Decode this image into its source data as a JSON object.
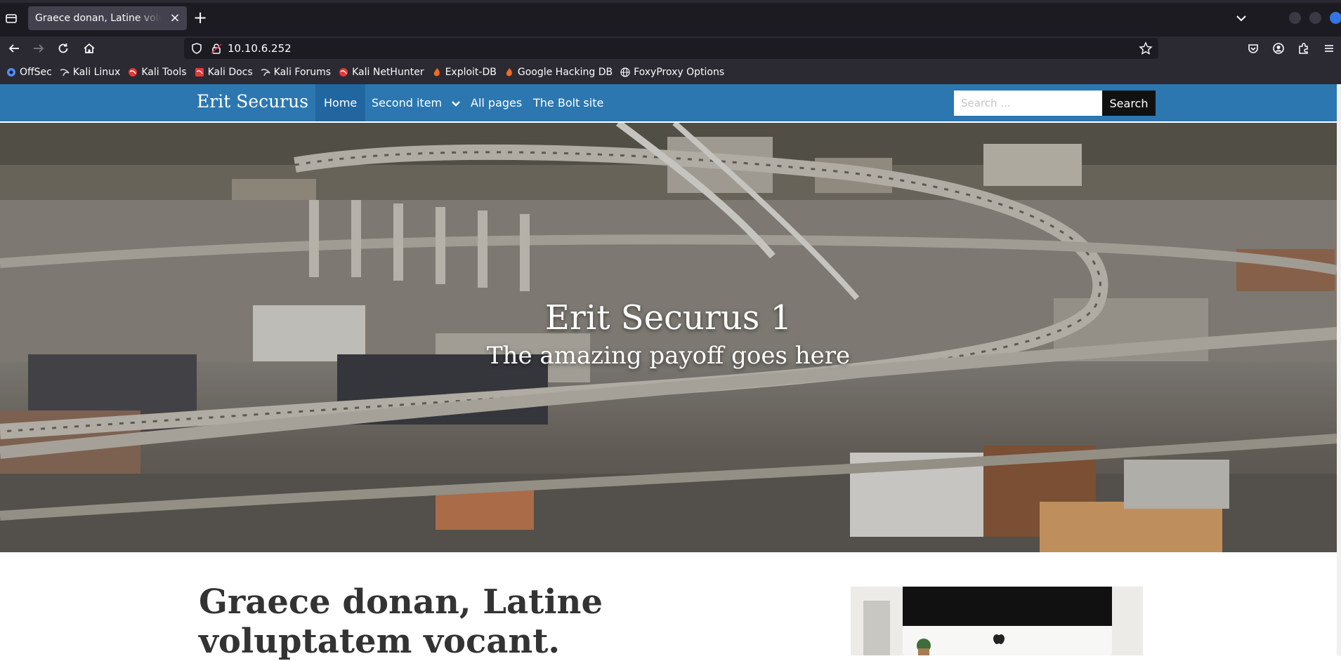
{
  "browser": {
    "tab": {
      "title": "Graece donan, Latine voluptatem vocant."
    },
    "url": "10.10.6.252",
    "bookmarks": [
      {
        "label": "OffSec",
        "icon": "offsec-icon"
      },
      {
        "label": "Kali Linux",
        "icon": "kali-dragon-icon"
      },
      {
        "label": "Kali Tools",
        "icon": "kali-tools-icon"
      },
      {
        "label": "Kali Docs",
        "icon": "kali-docs-icon"
      },
      {
        "label": "Kali Forums",
        "icon": "kali-dragon-icon"
      },
      {
        "label": "Kali NetHunter",
        "icon": "kali-nethunter-icon"
      },
      {
        "label": "Exploit-DB",
        "icon": "exploit-db-icon"
      },
      {
        "label": "Google Hacking DB",
        "icon": "exploit-db-icon"
      },
      {
        "label": "FoxyProxy Options",
        "icon": "globe-icon"
      }
    ]
  },
  "site": {
    "brand": "Erit Securus 1",
    "menu": [
      {
        "label": "Home",
        "active": true
      },
      {
        "label": "Second item",
        "dropdown": true
      },
      {
        "label": "All pages"
      },
      {
        "label": "The Bolt site"
      }
    ],
    "search": {
      "placeholder": "Search ...",
      "button": "Search"
    },
    "hero": {
      "title": "Erit Securus 1",
      "subtitle": "The amazing payoff goes here"
    },
    "article": {
      "title": "Graece donan, Latine voluptatem vocant."
    }
  },
  "colors": {
    "nav_bg": "#2c77b0",
    "nav_active": "#2266a0",
    "browser_dark": "#1c1b22",
    "browser_toolbar": "#2b2a33"
  }
}
